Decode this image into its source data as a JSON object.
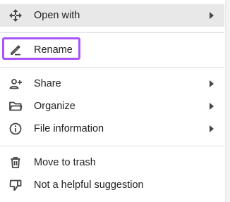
{
  "menu": {
    "items": [
      {
        "label": "Open with",
        "icon": "move-arrows-icon",
        "has_submenu": true
      },
      {
        "label": "Rename",
        "icon": "pencil-icon",
        "has_submenu": false
      },
      {
        "label": "Share",
        "icon": "add-person-icon",
        "has_submenu": true
      },
      {
        "label": "Organize",
        "icon": "folder-open-icon",
        "has_submenu": true
      },
      {
        "label": "File information",
        "icon": "info-circle-icon",
        "has_submenu": true
      },
      {
        "label": "Move to trash",
        "icon": "trash-icon",
        "has_submenu": false
      },
      {
        "label": "Not a helpful suggestion",
        "icon": "thumbs-down-icon",
        "has_submenu": false
      }
    ]
  },
  "colors": {
    "highlight_border": "#a855f7",
    "hover_background": "#e8e8e8",
    "text": "#202124",
    "icon": "#444746"
  }
}
